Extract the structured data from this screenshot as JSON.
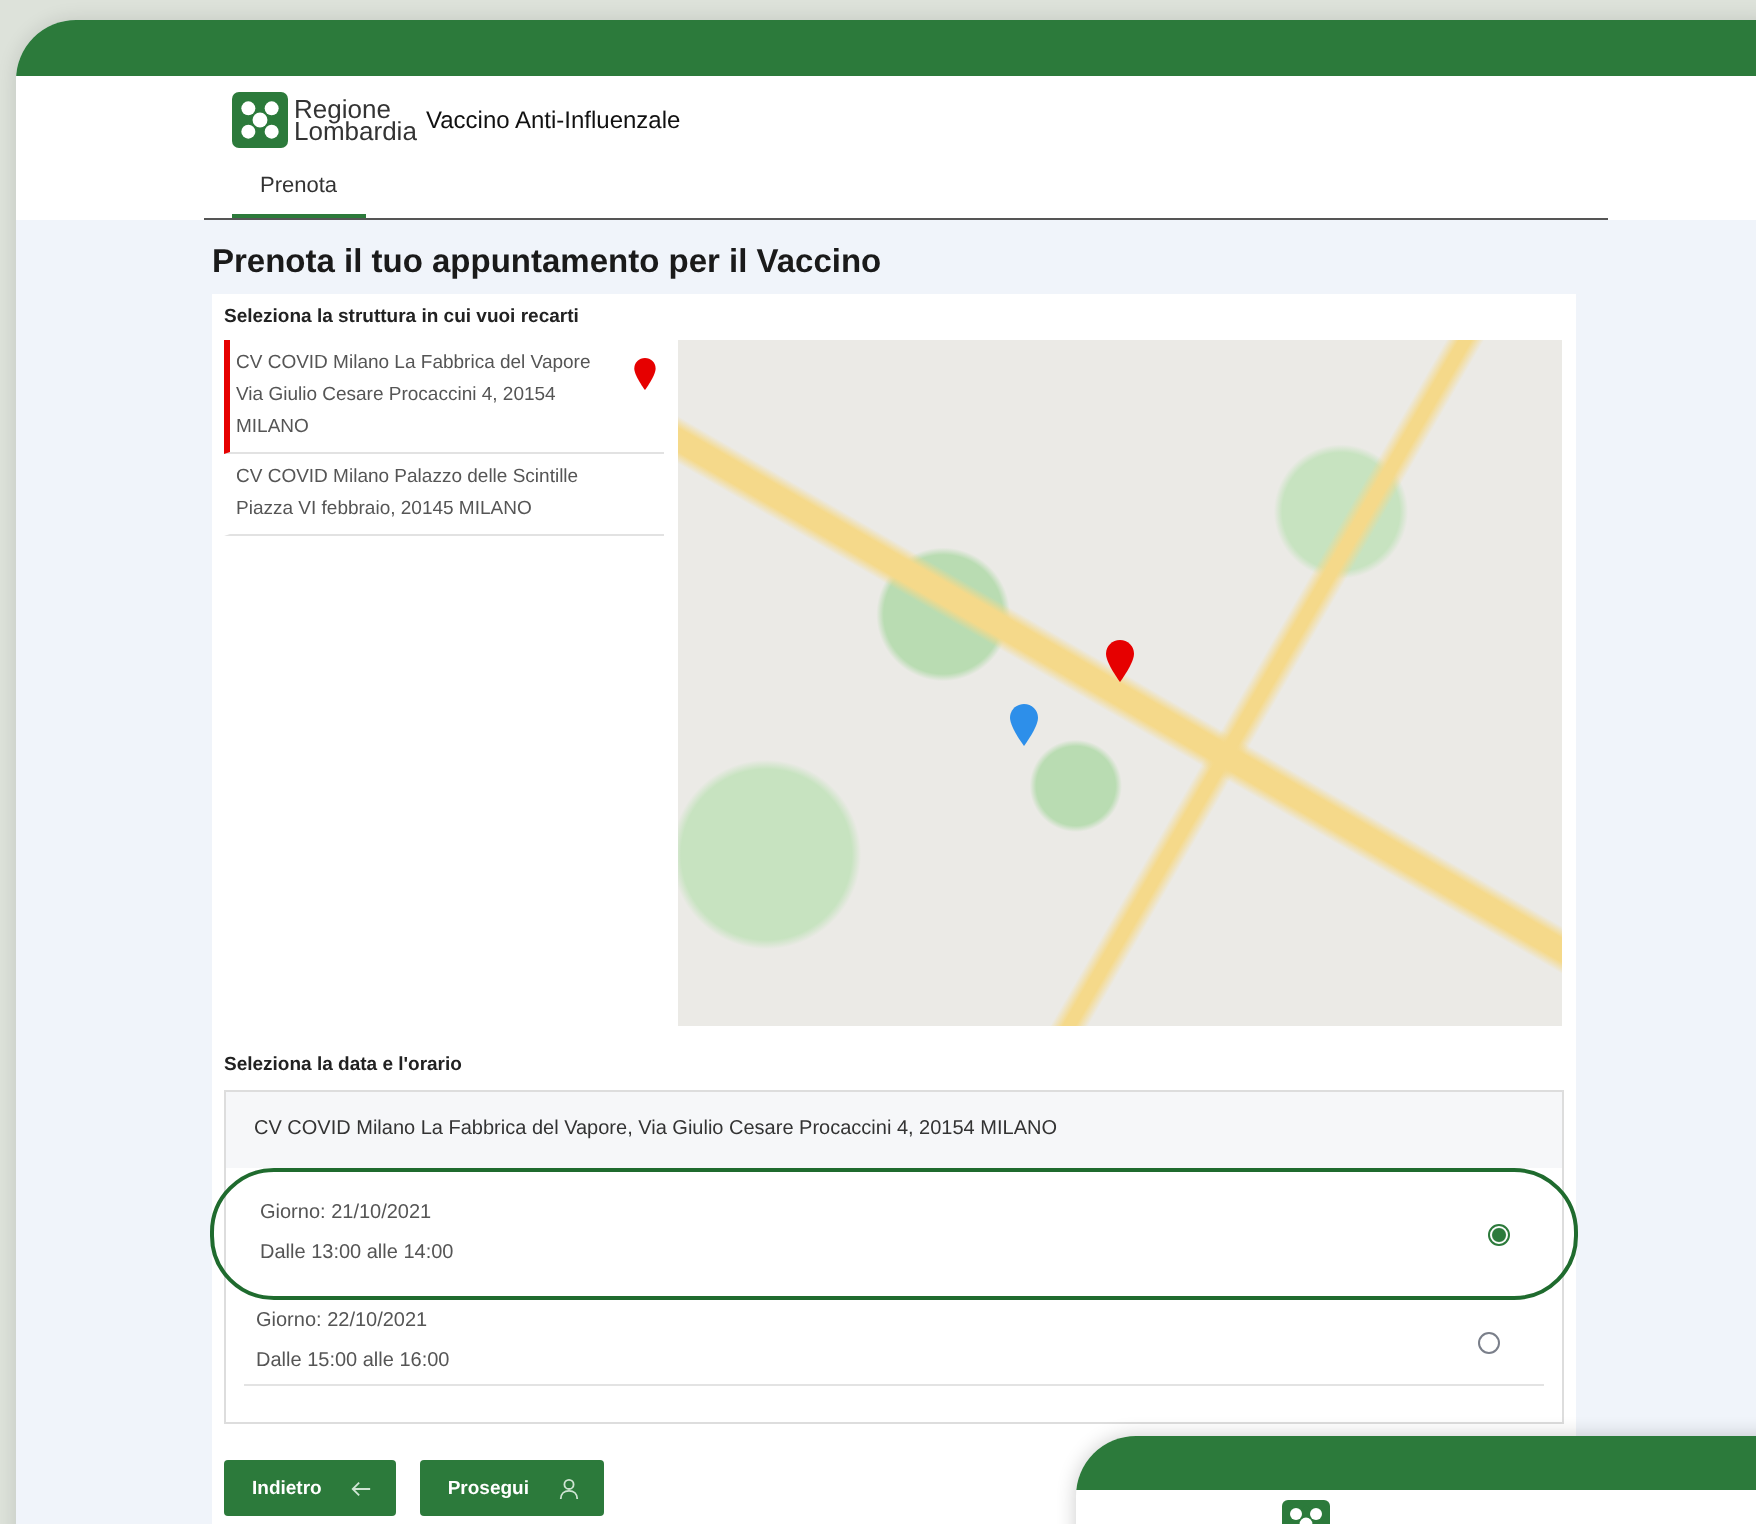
{
  "header": {
    "logo_text": "Regione Lombardia",
    "app_title": "Vaccino Anti-Influenzale"
  },
  "tabs": [
    {
      "label": "Prenota",
      "selected": true
    }
  ],
  "page_title": "Prenota il tuo appuntamento per il Vaccino",
  "location_section": {
    "label": "Seleziona la struttura in cui vuoi recarti",
    "locations": [
      {
        "name": "CV COVID Milano La Fabbrica del Vapore",
        "address": "Via Giulio Cesare Procaccini 4, 20154 MILANO",
        "selected": true
      },
      {
        "name": "CV COVID Milano Palazzo delle Scintille",
        "address": "Piazza VI febbraio, 20145 MILANO",
        "selected": false
      }
    ]
  },
  "slot_section": {
    "label": "Seleziona la data e l'orario",
    "location": "CV COVID Milano La Fabbrica del Vapore, Via Giulio Cesare Procaccini 4, 20154 MILANO",
    "slots": [
      {
        "day": "Giorno: 21/10/2021",
        "time": "Dalle 13:00 alle 14:00",
        "selected": true
      },
      {
        "day": "Giorno: 22/10/2021",
        "time": "Dalle 15:00 alle 16:00",
        "selected": false
      }
    ]
  },
  "buttons": [
    {
      "label": "Indietro",
      "kind": "back"
    },
    {
      "label": "Prosegui",
      "kind": "next"
    }
  ]
}
